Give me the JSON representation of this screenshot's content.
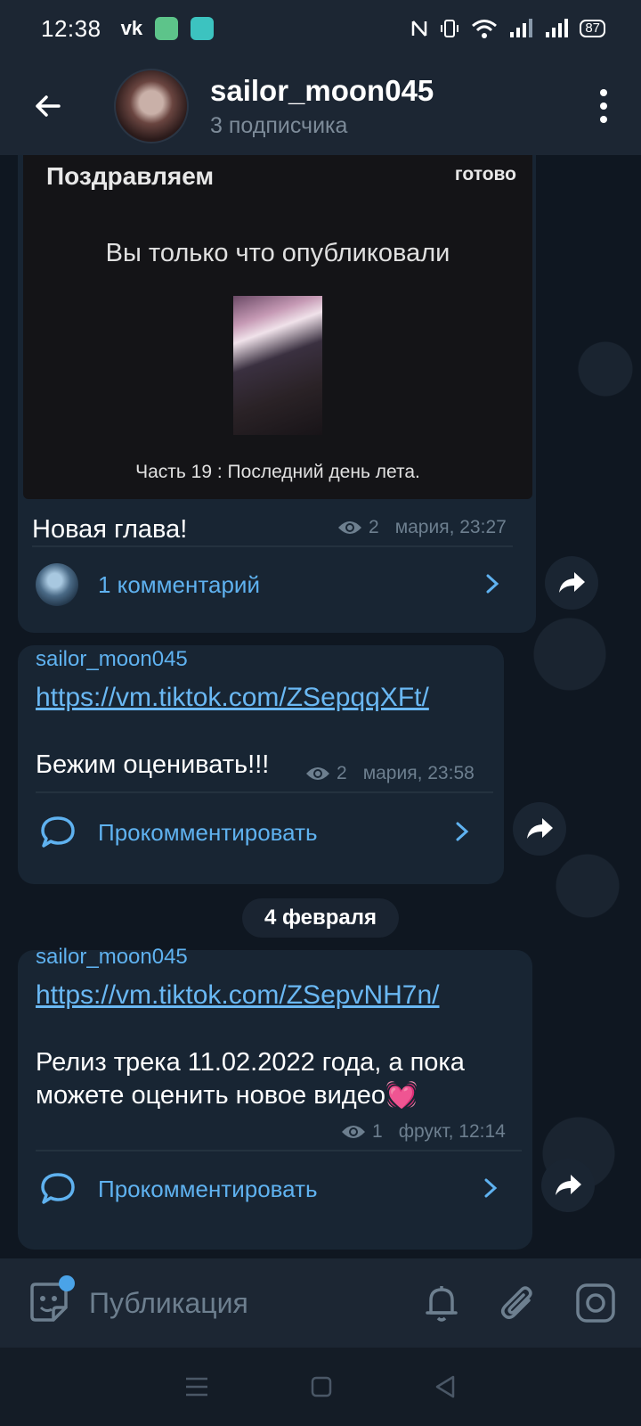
{
  "status_bar": {
    "time": "12:38",
    "vk": "vk",
    "battery": "87"
  },
  "header": {
    "channel_name": "sailor_moon045",
    "subscribers": "3 подписчика"
  },
  "post1": {
    "embed_title": "Поздравляем",
    "embed_done": "готово",
    "embed_subtitle": "Вы только что опубликовали",
    "embed_caption": "Часть 19 : Последний день лета.",
    "text": "Новая глава!",
    "views": "2",
    "date": "мария, 23:27",
    "comments": "1 комментарий"
  },
  "post2": {
    "author": "sailor_moon045",
    "link": "https://vm.tiktok.com/ZSepqqXFt/",
    "text": "Бежим оценивать!!!",
    "views": "2",
    "date": "мария, 23:58",
    "comment_label": "Прокомментировать"
  },
  "date_separator": "4 февраля",
  "post3": {
    "author": "sailor_moon045",
    "link": "https://vm.tiktok.com/ZSepvNH7n/",
    "text_line1": "Релиз трека 11.02.2022 года, а пока",
    "text_line2": "можете оценить новое видео💓",
    "views": "1",
    "date": "фрукт, 12:14",
    "comment_label": "Прокомментировать"
  },
  "input": {
    "placeholder": "Публикация"
  },
  "colors": {
    "accent": "#5fb2f0",
    "bubble": "#182533",
    "background": "#0f1721",
    "header": "#1c2633"
  }
}
